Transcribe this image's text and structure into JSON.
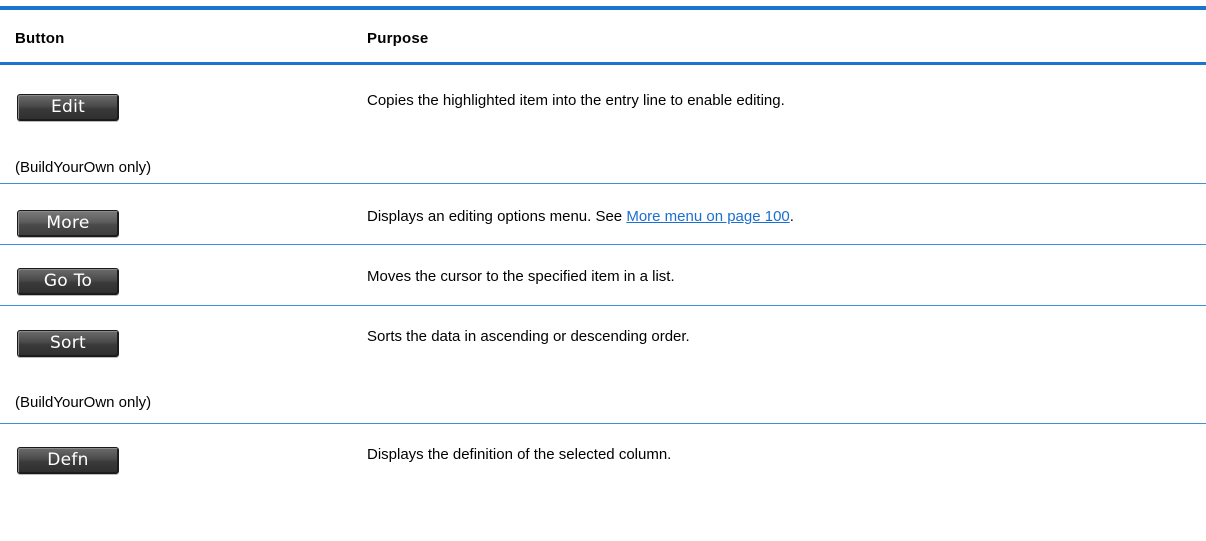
{
  "table": {
    "headers": {
      "button": "Button",
      "purpose": "Purpose"
    },
    "rows": [
      {
        "button_label": "Edit",
        "purpose": "Copies the highlighted item into the entry line to enable editing.",
        "note": "(BuildYourOwn only)"
      },
      {
        "button_label": "More",
        "purpose_prefix": "Displays an editing options menu. See ",
        "purpose_link": "More menu on page 100",
        "purpose_suffix": "."
      },
      {
        "button_label": "Go To",
        "purpose": "Moves the cursor to the specified item in a list."
      },
      {
        "button_label": "Sort",
        "purpose": "Sorts the data in ascending or descending order.",
        "note": "(BuildYourOwn only)"
      },
      {
        "button_label": "Defn",
        "purpose": "Displays the definition of the selected column."
      }
    ]
  },
  "colors": {
    "rule": "#1b75cf",
    "link": "#1b6fd1",
    "softkey_bg": "#3a3a3a",
    "softkey_text": "#ffffff"
  }
}
